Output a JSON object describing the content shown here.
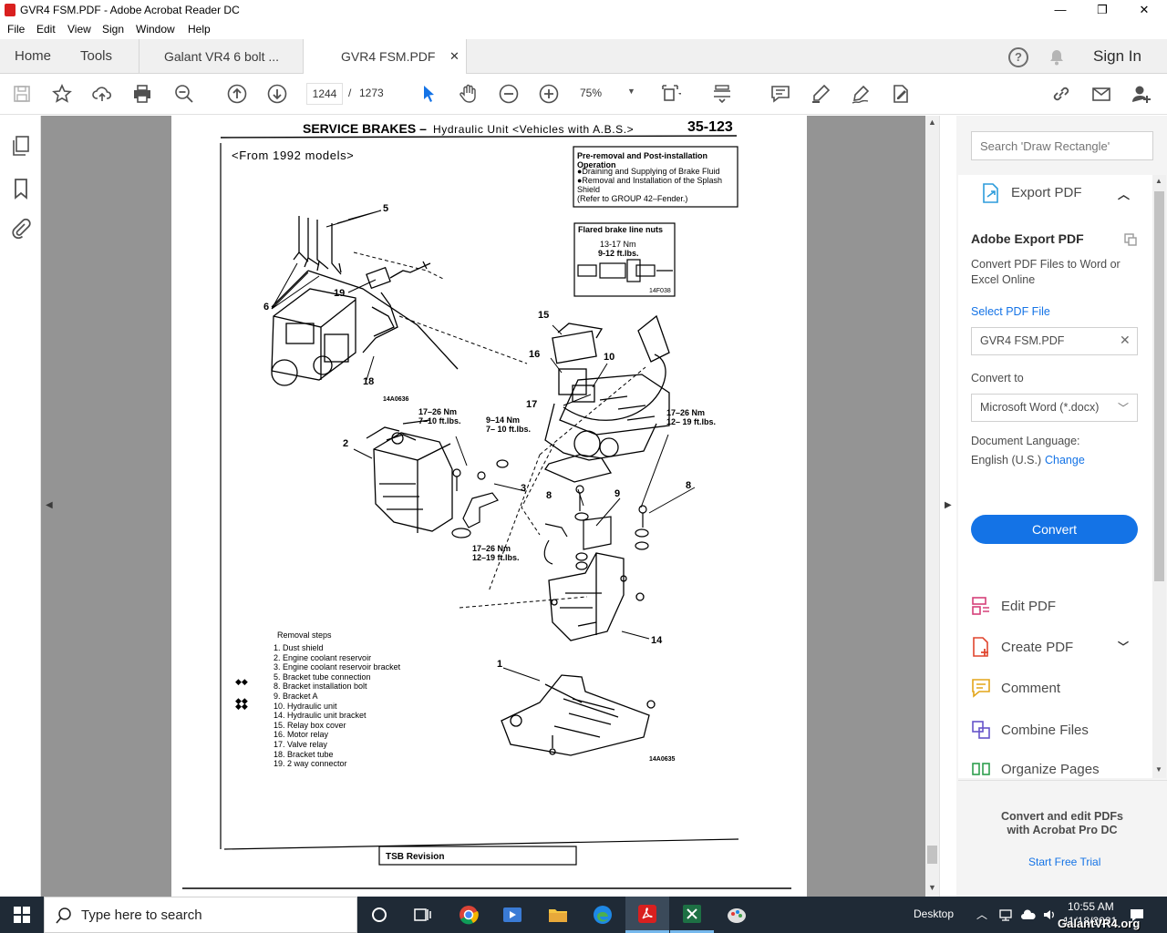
{
  "window": {
    "title": "GVR4 FSM.PDF - Adobe Acrobat Reader DC",
    "controls": [
      "—",
      "❐",
      "✕"
    ]
  },
  "menubar": [
    "File",
    "Edit",
    "View",
    "Sign",
    "Window",
    "Help"
  ],
  "tabs": {
    "home": "Home",
    "tools": "Tools",
    "doc1": "Galant VR4 6 bolt ...",
    "doc2": "GVR4 FSM.PDF",
    "sign_in": "Sign In"
  },
  "toolbar": {
    "current_page": "1244",
    "page_separator": "/",
    "total_pages": "1273",
    "zoom": "75%"
  },
  "document": {
    "header_title": "SERVICE BRAKES –",
    "header_sub": "Hydraulic Unit <Vehicles with A.B.S.>",
    "page_number": "35-123",
    "models_note": "<From 1992 models>",
    "preremoval_title": "Pre-removal and Post-installation Operation",
    "preremoval_lines": [
      "●Draining and Supplying of Brake Fluid",
      "●Removal and Installation of the Splash",
      "Shield",
      "(Refer to GROUP 42–Fender.)"
    ],
    "flare_title": "Flared brake line nuts",
    "flare_torque_nm": "13-17 Nm",
    "flare_torque_lbs": "9-12 ft.lbs.",
    "flare_code": "14F038",
    "fig_code_1": "14A0636",
    "fig_code_2": "14A0635",
    "torque_1": [
      "17–26 Nm",
      "7–10 ft.lbs."
    ],
    "torque_2": [
      "9–14 Nm",
      "7– 10 ft.lbs."
    ],
    "torque_3": [
      "17–26 Nm",
      "12– 19 ft.lbs."
    ],
    "torque_4": [
      "17–26 Nm",
      "12–19 ft.lbs."
    ],
    "callouts": [
      "5",
      "6",
      "19",
      "18",
      "15",
      "16",
      "10",
      "17",
      "2",
      "3",
      "8",
      "9",
      "8",
      "14",
      "1"
    ],
    "removal_title": "Removal steps",
    "removal_steps": [
      "1. Dust shield",
      "2. Engine coolant reservoir",
      "3. Engine coolant reservoir bracket",
      "5. Bracket tube connection",
      "8. Bracket installation bolt",
      "9. Bracket A",
      "10. Hydraulic unit",
      "14. Hydraulic unit bracket",
      "15. Relay box cover",
      "16. Motor relay",
      "17. Valve relay",
      "18. Bracket tube",
      "19. 2 way connector"
    ],
    "tsb": "TSB Revision"
  },
  "right_panel": {
    "search_placeholder": "Search 'Draw Rectangle'",
    "export_title": "Export PDF",
    "adobe_export_title": "Adobe Export PDF",
    "adobe_export_desc": "Convert PDF Files to Word or Excel Online",
    "select_file_label": "Select PDF File",
    "selected_file": "GVR4 FSM.PDF",
    "convert_to_label": "Convert to",
    "convert_to_value": "Microsoft Word (*.docx)",
    "doc_lang_label": "Document Language:",
    "doc_lang_value": "English (U.S.)",
    "change_link": "Change",
    "convert_button": "Convert",
    "tools": [
      "Edit PDF",
      "Create PDF",
      "Comment",
      "Combine Files",
      "Organize Pages"
    ],
    "promo_text": "Convert and edit PDFs with Acrobat Pro DC",
    "trial_link": "Start Free Trial"
  },
  "taskbar": {
    "search_placeholder": "Type here to search",
    "desktop_label": "Desktop",
    "time": "10:55 AM",
    "date": "11/18/2021",
    "watermark": "GalantVR4.org"
  },
  "colors": {
    "accent_blue": "#1473e6",
    "doc_bg": "#949494",
    "taskbar": "#1f2a36"
  }
}
